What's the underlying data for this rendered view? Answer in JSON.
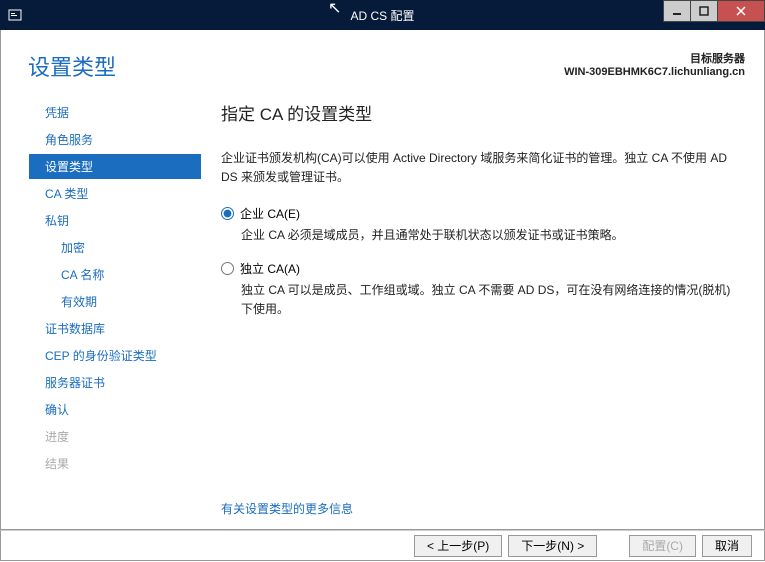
{
  "window": {
    "title": "AD CS 配置"
  },
  "header": {
    "page_title": "设置类型",
    "target_label": "目标服务器",
    "target_value": "WIN-309EBHMK6C7.lichunliang.cn"
  },
  "nav": {
    "items": [
      {
        "label": "凭据",
        "state": "normal"
      },
      {
        "label": "角色服务",
        "state": "normal"
      },
      {
        "label": "设置类型",
        "state": "selected"
      },
      {
        "label": "CA 类型",
        "state": "normal"
      },
      {
        "label": "私钥",
        "state": "normal"
      },
      {
        "label": "加密",
        "state": "normal",
        "indent": true
      },
      {
        "label": "CA 名称",
        "state": "normal",
        "indent": true
      },
      {
        "label": "有效期",
        "state": "normal",
        "indent": true
      },
      {
        "label": "证书数据库",
        "state": "normal"
      },
      {
        "label": "CEP 的身份验证类型",
        "state": "normal"
      },
      {
        "label": "服务器证书",
        "state": "normal"
      },
      {
        "label": "确认",
        "state": "normal"
      },
      {
        "label": "进度",
        "state": "disabled"
      },
      {
        "label": "结果",
        "state": "disabled"
      }
    ]
  },
  "main": {
    "heading": "指定 CA 的设置类型",
    "description": "企业证书颁发机构(CA)可以使用 Active Directory 域服务来简化证书的管理。独立 CA 不使用 AD DS 来颁发或管理证书。",
    "options": [
      {
        "label": "企业 CA(E)",
        "desc": "企业 CA 必须是域成员，并且通常处于联机状态以颁发证书或证书策略。",
        "checked": true
      },
      {
        "label": "独立 CA(A)",
        "desc": "独立 CA 可以是成员、工作组或域。独立 CA 不需要 AD DS，可在没有网络连接的情况(脱机)下使用。",
        "checked": false
      }
    ],
    "more_info": "有关设置类型的更多信息"
  },
  "footer": {
    "prev": "< 上一步(P)",
    "next": "下一步(N) >",
    "configure": "配置(C)",
    "cancel": "取消"
  }
}
